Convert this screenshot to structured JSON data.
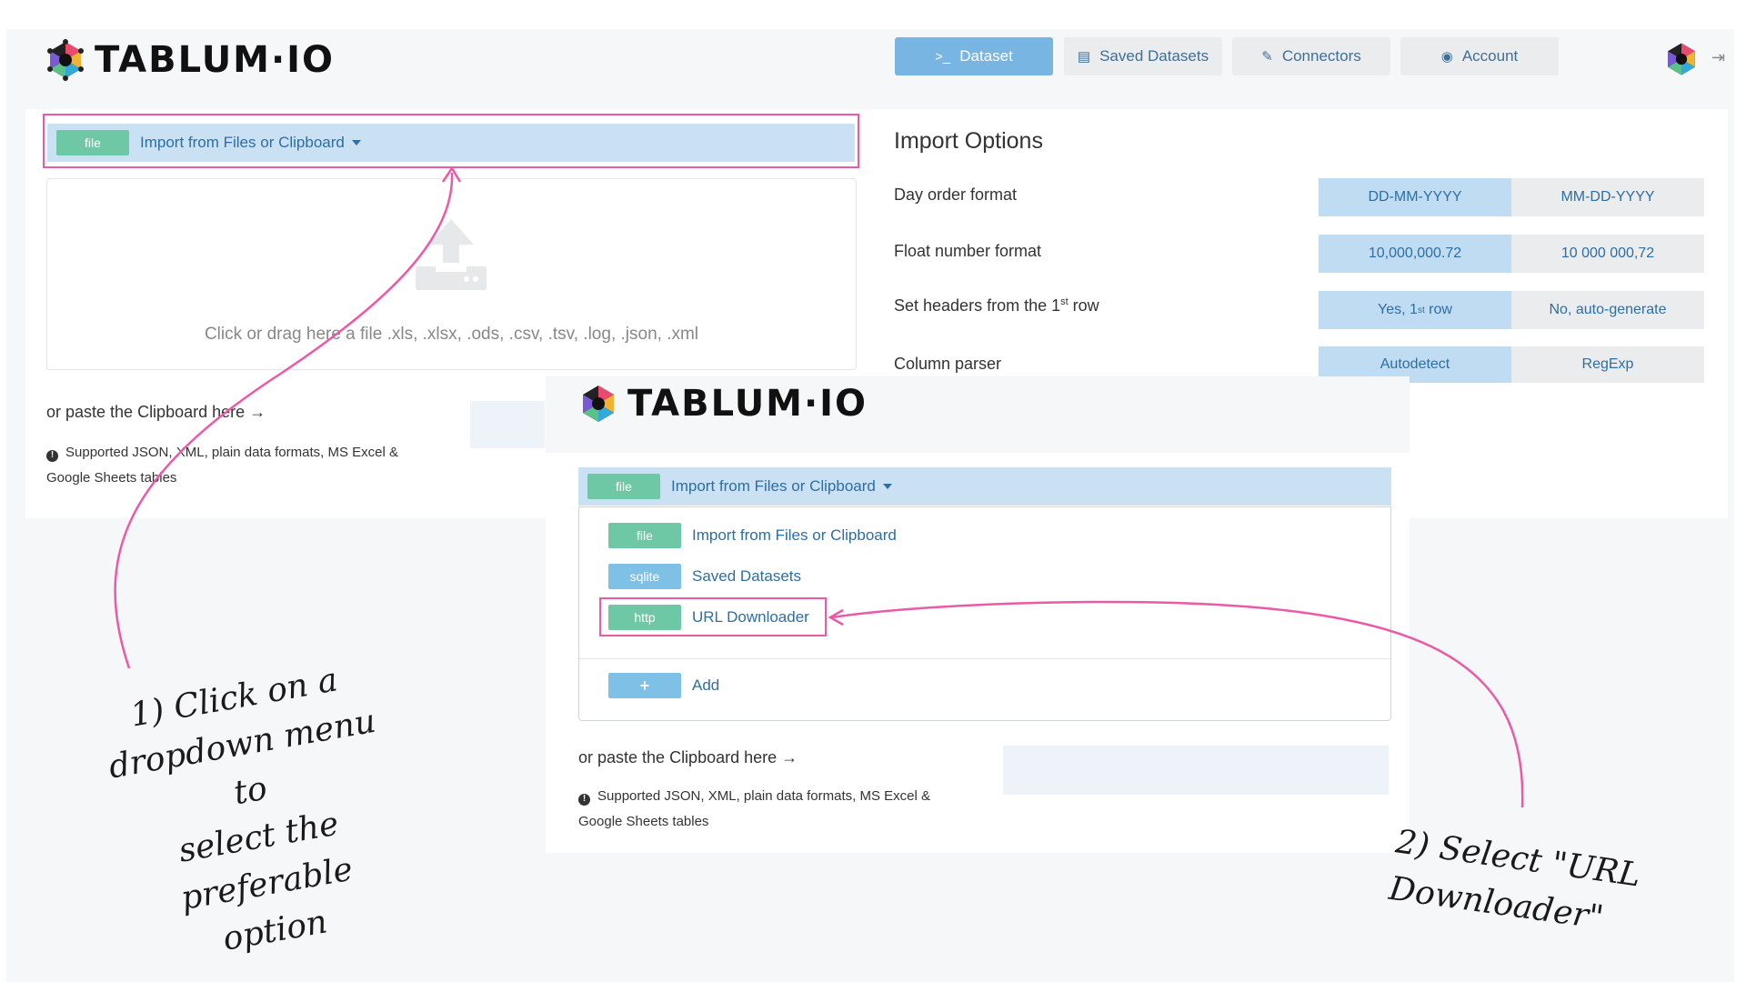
{
  "app": {
    "logo_text": "TABLUM·IO"
  },
  "nav": {
    "dataset": "Dataset",
    "saved": "Saved Datasets",
    "connectors": "Connectors",
    "account": "Account"
  },
  "importer": {
    "tag": "file",
    "label": "Import from Files or Clipboard",
    "dropzone_text": "Click or drag here a file .xls, .xlsx, .ods, .csv, .tsv, .log, .json, .xml",
    "paste_label": "or paste the Clipboard here →",
    "note": "Supported JSON, XML, plain data formats, MS Excel & Google Sheets tables"
  },
  "options": {
    "title": "Import Options",
    "rows": [
      {
        "label": "Day order format",
        "a": "DD-MM-YYYY",
        "b": "MM-DD-YYYY"
      },
      {
        "label": "Float number format",
        "a": "10,000,000.72",
        "b": "10 000 000,72"
      },
      {
        "label_pre": "Set headers from the 1",
        "label_sup": "st",
        "label_post": " row",
        "a_pre": "Yes, 1",
        "a_sup": "st",
        "a_post": " row",
        "b": "No, auto-generate"
      },
      {
        "label": "Column parser",
        "a": "Autodetect",
        "b": "RegExp"
      }
    ]
  },
  "inset": {
    "logo_text": "TABLUM·IO",
    "tag": "file",
    "label": "Import from Files or Clipboard",
    "items": [
      {
        "tag": "file",
        "label": "Import from Files or Clipboard"
      },
      {
        "tag": "sqlite",
        "label": "Saved Datasets"
      },
      {
        "tag": "http",
        "label": "URL Downloader"
      },
      {
        "tag": "+",
        "label": "Add"
      }
    ],
    "paste_label": "or paste the Clipboard here →",
    "note": "Supported JSON, XML, plain data formats, MS Excel & Google Sheets tables"
  },
  "annotations": {
    "step1": [
      "1) Click on a",
      "dropdown menu to",
      "select the preferable",
      "option"
    ],
    "step2": [
      "2) Select \"URL",
      "Downloader\""
    ]
  },
  "colors": {
    "accent": "#ea5aa6",
    "nav_active": "#78b5e3",
    "bar": "#c9e1f3",
    "file_tag": "#6fc8a5",
    "sqlite_tag": "#7ec0e6"
  },
  "icons": [
    "terminal-icon",
    "archive-icon",
    "plug-icon",
    "user-circle-icon",
    "logout-icon",
    "upload-icon",
    "info-icon",
    "caret-down-icon"
  ]
}
